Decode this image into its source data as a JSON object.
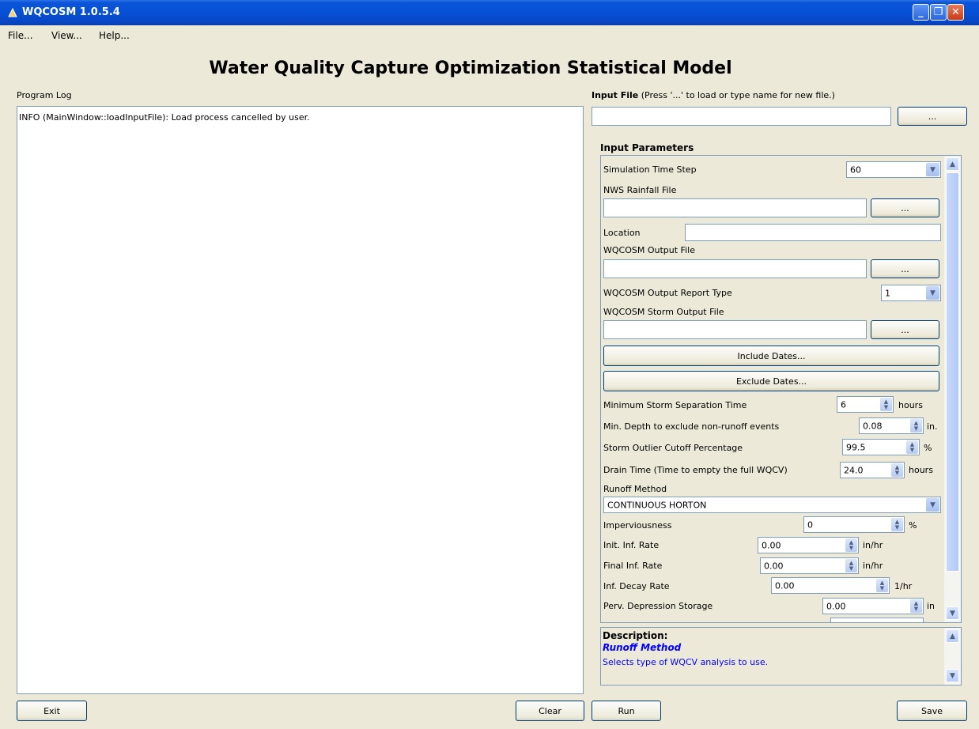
{
  "window": {
    "title": "WQCOSM 1.0.5.4"
  },
  "menu": {
    "file": "File...",
    "view": "View...",
    "help": "Help..."
  },
  "heading": "Water Quality Capture Optimization Statistical Model",
  "log": {
    "label": "Program Log",
    "lines": [
      "INFO (MainWindow::loadInputFile): Load process cancelled by user."
    ]
  },
  "input_file": {
    "label": "Input File",
    "hint": "(Press '...' to load or type name for new file.)",
    "value": "",
    "browse": "..."
  },
  "params": {
    "header": "Input Parameters",
    "sim_time_step": {
      "label": "Simulation Time Step",
      "value": "60"
    },
    "nws_rainfall": {
      "label": "NWS Rainfall File",
      "value": "",
      "browse": "..."
    },
    "location": {
      "label": "Location",
      "value": ""
    },
    "output_file": {
      "label": "WQCOSM Output File",
      "value": "",
      "browse": "..."
    },
    "report_type": {
      "label": "WQCOSM Output Report Type",
      "value": "1"
    },
    "storm_output": {
      "label": "WQCOSM Storm Output File",
      "value": "",
      "browse": "..."
    },
    "include_dates": "Include Dates...",
    "exclude_dates": "Exclude Dates...",
    "min_storm_sep": {
      "label": "Minimum Storm Separation Time",
      "value": "6",
      "unit": "hours"
    },
    "min_depth": {
      "label": "Min. Depth to exclude non-runoff events",
      "value": "0.08",
      "unit": "in."
    },
    "outlier_cutoff": {
      "label": "Storm Outlier Cutoff Percentage",
      "value": "99.5",
      "unit": "%"
    },
    "drain_time": {
      "label": "Drain Time (Time to empty the full WQCV)",
      "value": "24.0",
      "unit": "hours"
    },
    "runoff_method": {
      "label": "Runoff Method",
      "value": "CONTINUOUS HORTON"
    },
    "imperviousness": {
      "label": "Imperviousness",
      "value": "0",
      "unit": "%"
    },
    "init_inf_rate": {
      "label": "Init. Inf. Rate",
      "value": "0.00",
      "unit": "in/hr"
    },
    "final_inf_rate": {
      "label": "Final Inf. Rate",
      "value": "0.00",
      "unit": "in/hr"
    },
    "inf_decay_rate": {
      "label": "Inf. Decay Rate",
      "value": "0.00",
      "unit": "1/hr"
    },
    "perv_depression": {
      "label": "Perv. Depression Storage",
      "value": "0.00",
      "unit": "in"
    }
  },
  "description": {
    "header": "Description:",
    "title": "Runoff Method",
    "text": "Selects type of WQCV analysis to use."
  },
  "buttons": {
    "exit": "Exit",
    "clear": "Clear",
    "run": "Run",
    "save": "Save"
  },
  "colors": {
    "titlebar": "#0650d6",
    "desc_blue": "#0000ff",
    "background": "#ece9d8"
  }
}
